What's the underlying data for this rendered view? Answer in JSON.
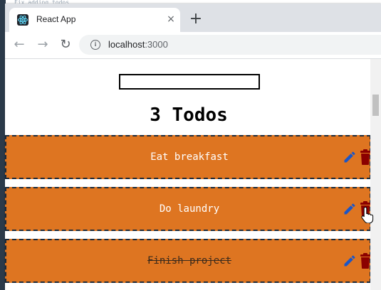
{
  "background": {
    "top_text": "Fix adding todos"
  },
  "browser": {
    "tab": {
      "title": "React App",
      "favicon": "react-icon"
    },
    "new_tab_label": "+",
    "close_tab_label": "×",
    "nav": {
      "back": "←",
      "forward": "→",
      "reload": "↻"
    },
    "url": {
      "host": "localhost",
      "port": ":3000"
    }
  },
  "page": {
    "search": {
      "value": "",
      "placeholder": ""
    },
    "heading": "3 Todos",
    "todos": [
      {
        "text": "Eat breakfast",
        "completed": false
      },
      {
        "text": "Do laundry",
        "completed": false
      },
      {
        "text": "Finish project",
        "completed": true
      }
    ],
    "icons": {
      "edit": "pencil-icon",
      "delete": "trash-icon"
    },
    "colors": {
      "todo_bg": "#de7521",
      "edit_icon": "#1a56c8",
      "delete_icon": "#8b0000"
    }
  }
}
